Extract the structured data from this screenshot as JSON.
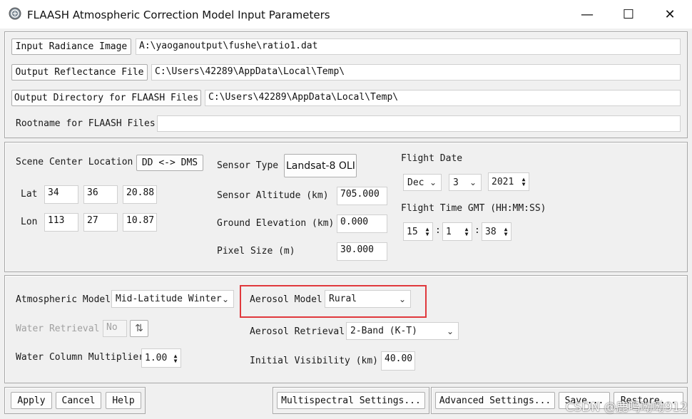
{
  "window": {
    "title": "FLAASH Atmospheric Correction Model Input Parameters",
    "minimize": "—",
    "maximize": "☐",
    "close": "✕"
  },
  "files": {
    "input_radiance_button": "Input Radiance Image",
    "input_radiance_value": "A:\\yaoganoutput\\fushe\\ratio1.dat",
    "output_reflectance_button": "Output Reflectance File",
    "output_reflectance_value": "C:\\Users\\42289\\AppData\\Local\\Temp\\",
    "output_directory_button": "Output Directory for FLAASH Files",
    "output_directory_value": "C:\\Users\\42289\\AppData\\Local\\Temp\\",
    "rootname_label": "Rootname for FLAASH Files",
    "rootname_value": ""
  },
  "scene": {
    "center_label": "Scene Center Location",
    "dd_dms_button": "DD <-> DMS",
    "lat_label": "Lat",
    "lat": [
      "34",
      "36",
      "20.88"
    ],
    "lon_label": "Lon",
    "lon": [
      "113",
      "27",
      "10.87"
    ],
    "sensor_type_label": "Sensor Type",
    "sensor_type_value": "Landsat-8 OLI",
    "sensor_altitude_label": "Sensor Altitude (km)",
    "sensor_altitude_value": "705.000",
    "ground_elevation_label": "Ground Elevation (km)",
    "ground_elevation_value": "0.000",
    "pixel_size_label": "Pixel Size (m)",
    "pixel_size_value": "30.000",
    "flight_date_label": "Flight Date",
    "month": "Dec",
    "day": "3",
    "year": "2021",
    "flight_time_label": "Flight Time GMT (HH:MM:SS)",
    "hour": "15",
    "minute": "1",
    "second": "38",
    "colon": ":"
  },
  "atmos": {
    "atmospheric_model_label": "Atmospheric Model",
    "atmospheric_model_value": "Mid-Latitude Winter",
    "water_retrieval_label": "Water Retrieval",
    "water_retrieval_value": "No",
    "water_column_label": "Water Column Multiplier",
    "water_column_value": "1.00",
    "aerosol_model_label": "Aerosol Model",
    "aerosol_model_value": "Rural",
    "aerosol_retrieval_label": "Aerosol Retrieval",
    "aerosol_retrieval_value": "2-Band (K-T)",
    "initial_visibility_label": "Initial Visibility (km)",
    "initial_visibility_value": "40.00"
  },
  "footer": {
    "apply": "Apply",
    "cancel": "Cancel",
    "help": "Help",
    "multispectral": "Multispectral Settings...",
    "advanced": "Advanced Settings...",
    "save": "Save...",
    "restore": "Restore..."
  },
  "watermark": "CSDN @鹿鸣呦呦912",
  "colors": {
    "highlight": "#e0383c",
    "background": "#f0f0f0"
  }
}
